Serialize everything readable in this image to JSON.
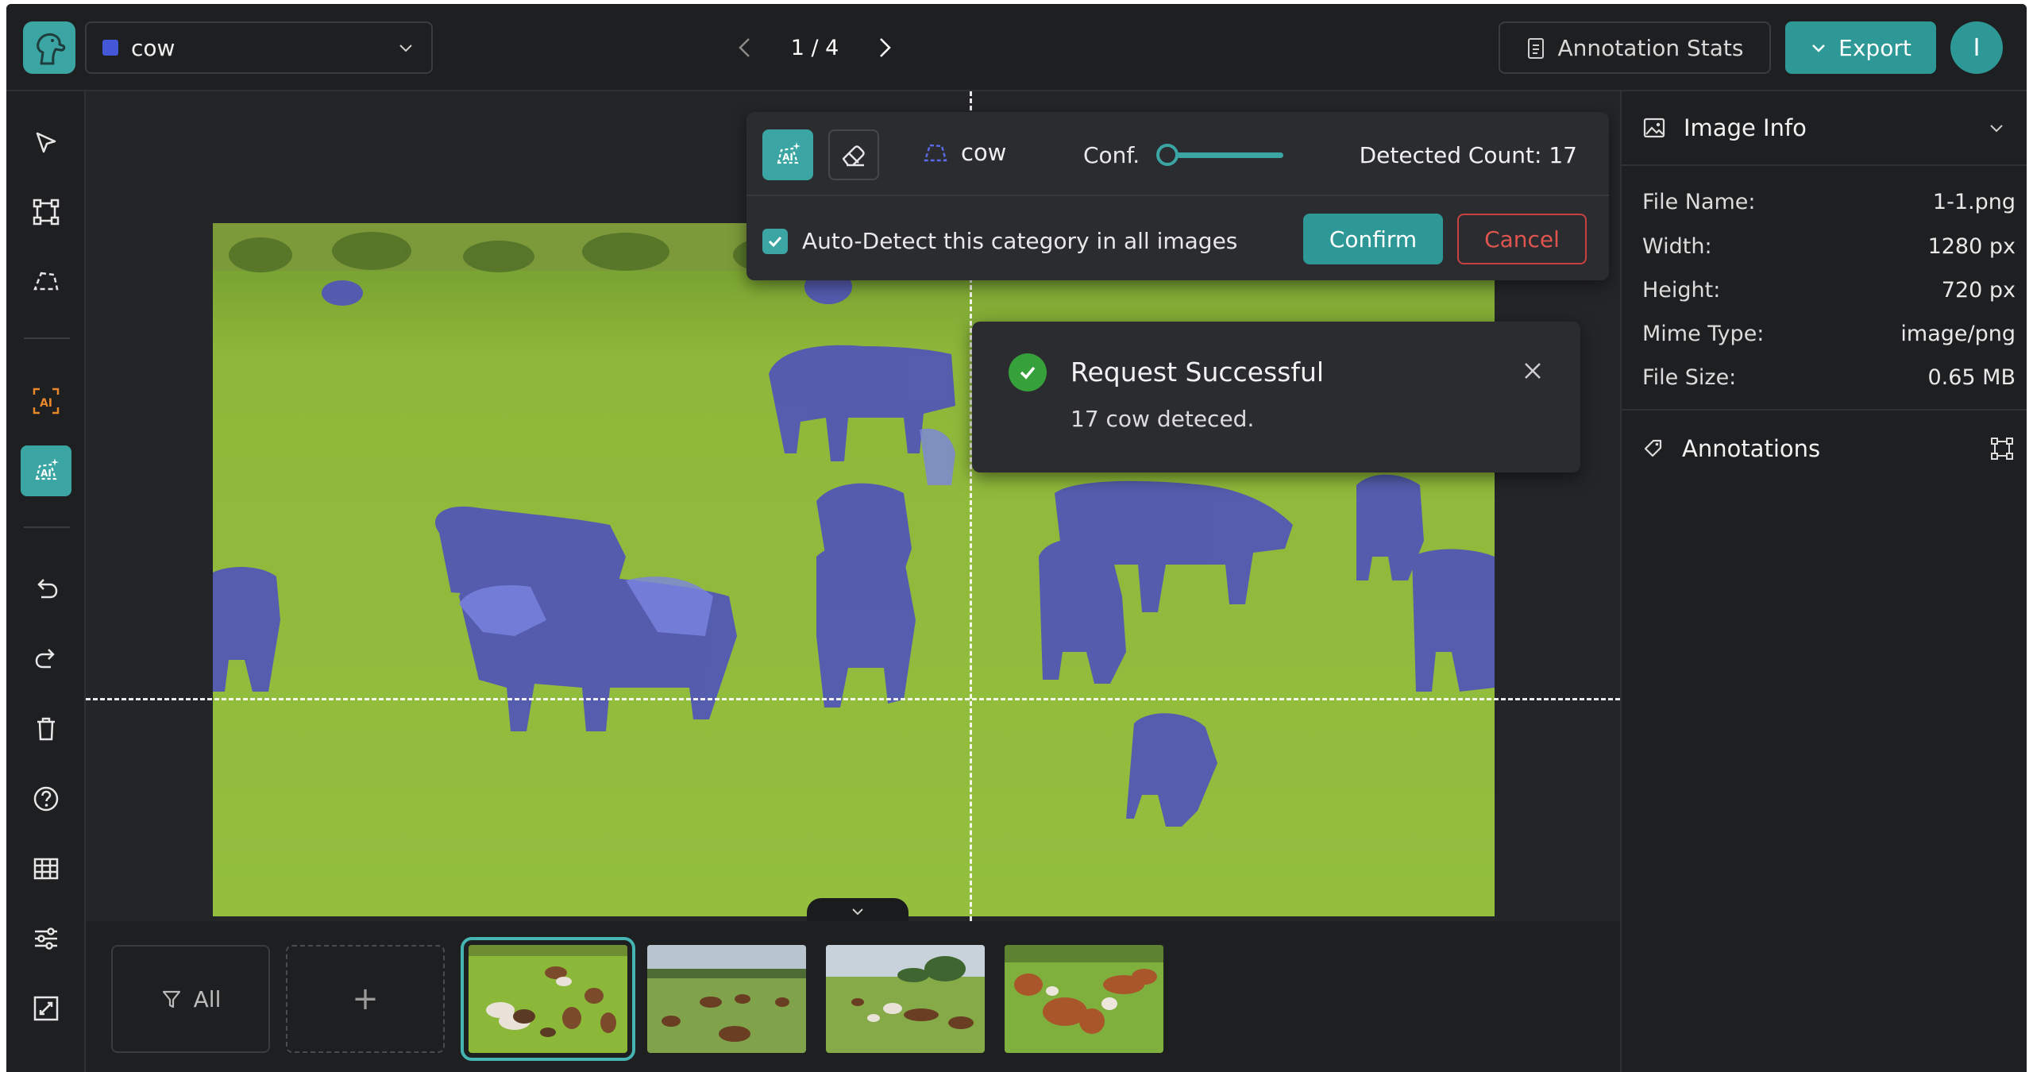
{
  "header": {
    "category": "cow",
    "page_indicator": "1 / 4",
    "stats_label": "Annotation Stats",
    "export_label": "Export",
    "avatar_initial": "I"
  },
  "colors": {
    "accent": "#3aa5a3",
    "category_color": "#4457d6",
    "danger": "#e0544f",
    "success": "#36a13a"
  },
  "toolbar": {
    "tools": [
      "select-icon",
      "bbox-icon",
      "polygon-icon",
      "ai-bbox-icon",
      "ai-smart-segment-icon",
      "undo-icon",
      "redo-icon",
      "trash-icon",
      "help-icon",
      "grid-icon",
      "sliders-icon",
      "fit-screen-icon"
    ],
    "active_tool": "ai-smart-segment-icon"
  },
  "ai_panel": {
    "category": "cow",
    "conf_label": "Conf.",
    "conf_value": 0.0,
    "detected_count": "Detected Count: 17",
    "auto_detect_label": "Auto-Detect this category in all images",
    "auto_detect_checked": true,
    "confirm_label": "Confirm",
    "cancel_label": "Cancel"
  },
  "toast": {
    "title": "Request Successful",
    "message": "17 cow deteced."
  },
  "filmstrip": {
    "filter_label": "All",
    "add_label": "+",
    "selected_index": 0,
    "thumbnail_count": 4
  },
  "image_info": {
    "title": "Image Info",
    "rows": [
      {
        "key": "File Name:",
        "value": "1-1.png"
      },
      {
        "key": "Width:",
        "value": "1280 px"
      },
      {
        "key": "Height:",
        "value": "720 px"
      },
      {
        "key": "Mime Type:",
        "value": "image/png"
      },
      {
        "key": "File Size:",
        "value": "0.65 MB"
      }
    ]
  },
  "annotations": {
    "title": "Annotations"
  }
}
